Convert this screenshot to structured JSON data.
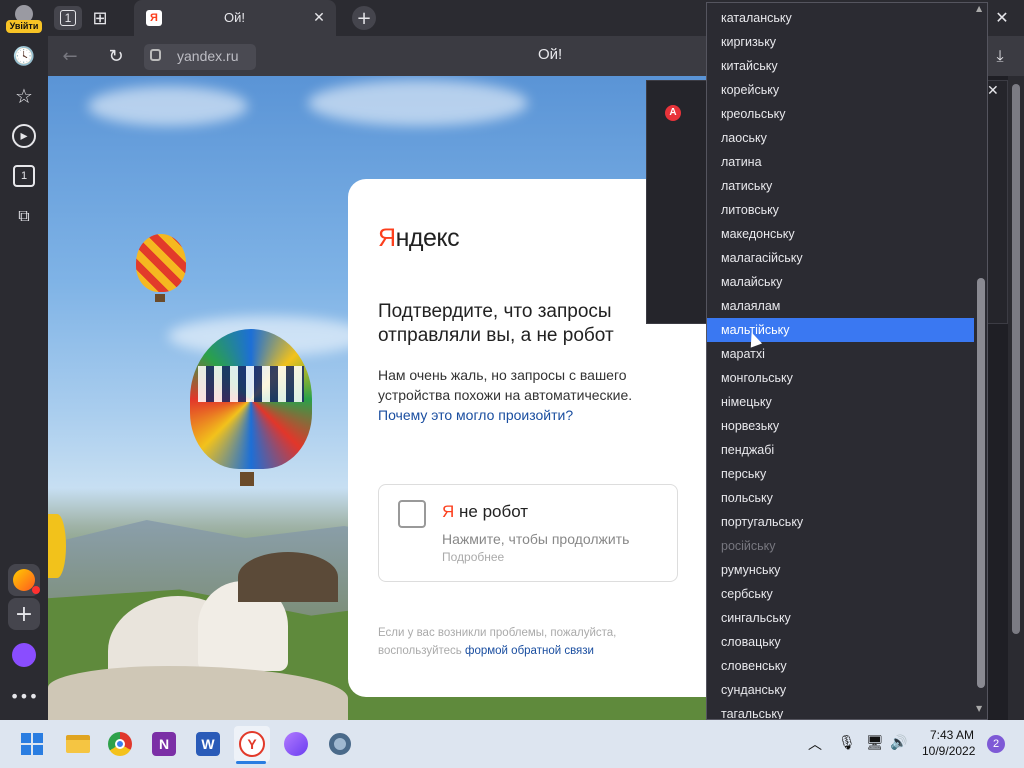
{
  "browser": {
    "profile_label": "Увійти",
    "tab_counter": "1",
    "tab_title": "Ой!",
    "page_title": "Ой!",
    "address": "yandex.ru",
    "sidebar_tab_count": "1"
  },
  "page": {
    "logo_first": "Я",
    "logo_rest": "ндекс",
    "heading": "Подтвердите, что запросы отправляли вы, а не робот",
    "description": "Нам очень жаль, но запросы с вашего устройства похожи на автоматические.",
    "why_link": "Почему это могло произойти?",
    "captcha_label_first": "Я",
    "captcha_label_rest": " не робот",
    "captcha_hint": "Нажмите, чтобы продолжить",
    "captcha_more": "Подробнее",
    "footer_text": "Если у вас возникли проблемы, пожалуйста, воспользуйтесь",
    "footer_link": "формой обратной связи"
  },
  "languages": [
    "каталанську",
    "киргизьку",
    "китайську",
    "корейську",
    "креольську",
    "лаоську",
    "латина",
    "латиську",
    "литовську",
    "македонську",
    "малагасійську",
    "малайську",
    "малаялам",
    "мальтійську",
    "маратхі",
    "монгольську",
    "німецьку",
    "норвезьку",
    "пенджабі",
    "перську",
    "польську",
    "португальську",
    "російську",
    "румунську",
    "сербську",
    "сингальську",
    "словацьку",
    "словенську",
    "сунданську",
    "тагальську"
  ],
  "selected_language": "мальтійську",
  "disabled_language": "російську",
  "taskbar": {
    "time": "7:43 AM",
    "date": "10/9/2022",
    "notifications": "2"
  },
  "colors": {
    "accent": "#3a78f2",
    "yandex_red": "#fc3f1d",
    "link": "#1a4ea0"
  }
}
